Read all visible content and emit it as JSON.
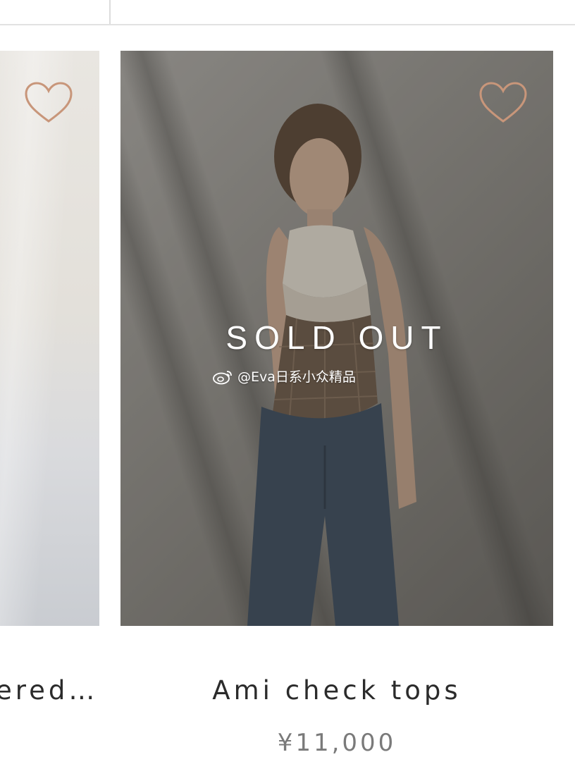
{
  "products": [
    {
      "title": "ered…",
      "sold_out": false,
      "favorite_icon": "heart-outline-icon"
    },
    {
      "title": "Ami check tops",
      "price": "¥11,000",
      "sold_out_label": "SOLD OUT",
      "watermark": "@Eva日系小众精品",
      "favorite_icon": "heart-outline-icon"
    }
  ],
  "colors": {
    "heart_stroke": "#c8967a",
    "title_text": "#2b2b2b",
    "price_text": "#7a7a7a",
    "sold_out_text": "#ffffff"
  }
}
